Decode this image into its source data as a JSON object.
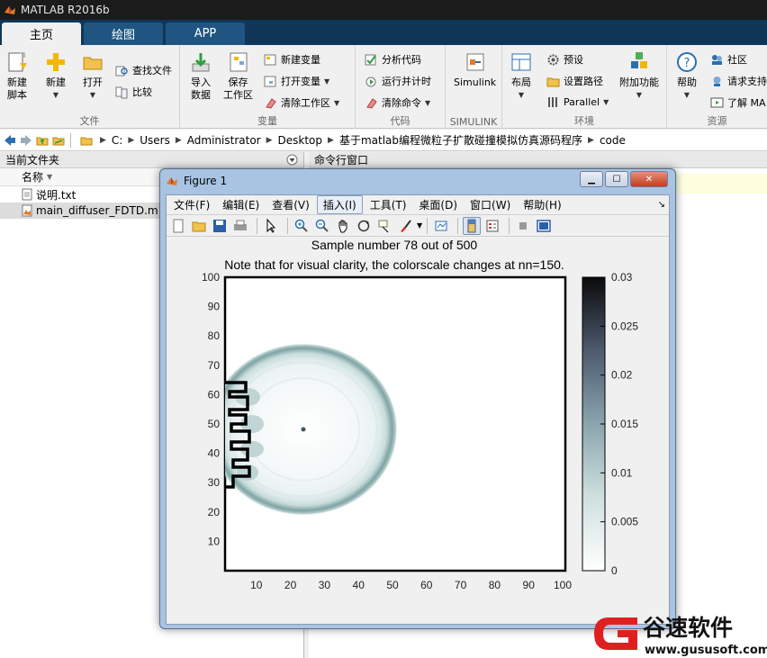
{
  "app": {
    "title": "MATLAB R2016b"
  },
  "tabs": [
    {
      "label": "主页",
      "active": true
    },
    {
      "label": "绘图",
      "active": false
    },
    {
      "label": "APP",
      "active": false
    }
  ],
  "ribbon": {
    "file": {
      "label": "文件",
      "new_script": [
        "新建",
        "脚本"
      ],
      "new": "新建",
      "open": "打开",
      "find_files": "查找文件",
      "compare": "比较"
    },
    "variable": {
      "label": "变量",
      "import": [
        "导入",
        "数据"
      ],
      "save_workspace": [
        "保存",
        "工作区"
      ],
      "new_variable": "新建变量",
      "open_variable": "打开变量",
      "clear_workspace": "清除工作区"
    },
    "code": {
      "label": "代码",
      "analyze": "分析代码",
      "run_time": "运行并计时",
      "clear_commands": "清除命令"
    },
    "simulink": {
      "label": "SIMULINK",
      "button": "Simulink"
    },
    "environment": {
      "label": "环境",
      "layout": "布局",
      "preferences": "预设",
      "set_path": "设置路径",
      "parallel": "Parallel",
      "addons": "附加功能"
    },
    "resources": {
      "label": "资源",
      "help": "帮助",
      "community": "社区",
      "request_support": "请求支持",
      "learn": "了解 MA"
    }
  },
  "address": {
    "path": [
      "C:",
      "Users",
      "Administrator",
      "Desktop",
      "基于matlab编程微粒子扩散碰撞模拟仿真源码程序",
      "code"
    ]
  },
  "left_panel": {
    "title": "当前文件夹",
    "column": "名称",
    "files": [
      {
        "name": "说明.txt",
        "selected": false
      },
      {
        "name": "main_diffuser_FDTD.m",
        "selected": true
      }
    ]
  },
  "command_window": {
    "title": "命令行窗口"
  },
  "figure": {
    "title": "Figure 1",
    "menu": [
      "文件(F)",
      "编辑(E)",
      "查看(V)",
      "插入(I)",
      "工具(T)",
      "桌面(D)",
      "窗口(W)",
      "帮助(H)"
    ],
    "highlighted_menu": "插入(I)",
    "plot": {
      "title_line1": "Sample number 78 out of 500",
      "title_line2": "Note that for visual clarity, the colorscale changes at nn=150.",
      "xticks": [
        "10",
        "20",
        "30",
        "40",
        "50",
        "60",
        "70",
        "80",
        "90",
        "100"
      ],
      "yticks": [
        "10",
        "20",
        "30",
        "40",
        "50",
        "60",
        "70",
        "80",
        "90",
        "100"
      ],
      "colorbar_ticks": [
        "0",
        "0.005",
        "0.01",
        "0.015",
        "0.02",
        "0.025",
        "0.03"
      ]
    }
  },
  "chart_data": {
    "type": "heatmap",
    "title": "Sample number 78 out of 500",
    "subtitle": "Note that for visual clarity, the colorscale changes at nn=150.",
    "xlim": [
      0,
      100
    ],
    "ylim": [
      0,
      100
    ],
    "colorbar_range": [
      0,
      0.03
    ],
    "colormap": "white-teal-black",
    "wavefront_center": [
      25,
      50
    ],
    "wavefront_radius_approx": 25,
    "grid": false
  },
  "watermark": {
    "brand": "谷速软件",
    "url": "www.gususoft.com"
  },
  "colors": {
    "ribbon_tab_bg": "#0f3657",
    "titlebar_bg": "#1b1b1b",
    "watermark_red": "#e02020",
    "wave_color": "#7fa3a3"
  }
}
